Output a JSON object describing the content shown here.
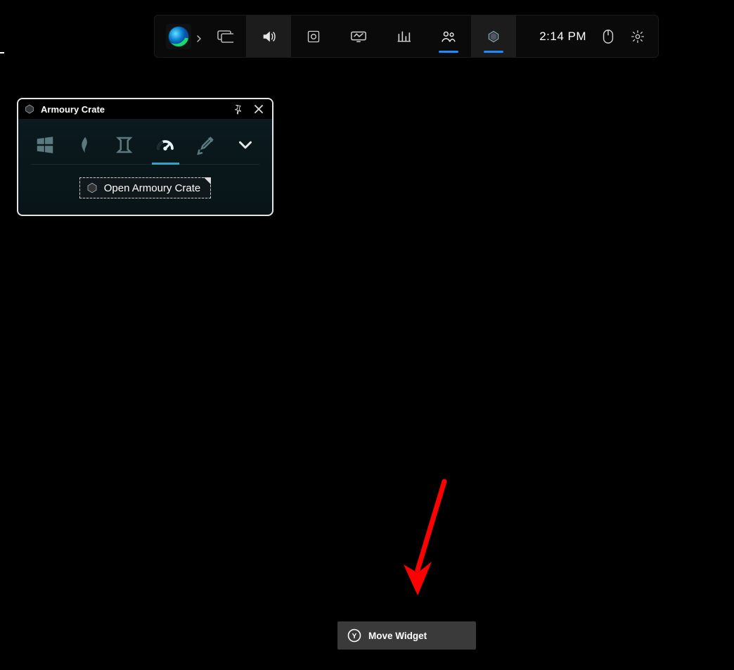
{
  "topbar": {
    "clock": "2:14 PM",
    "apps": {
      "edge_name": "edge-app"
    },
    "icons": {
      "audio": "audio-icon",
      "capture": "capture-icon",
      "projection": "projection-icon",
      "performance": "performance-icon",
      "xbox_social": "xbox-social-icon",
      "armoury_crate": "armoury-crate-icon",
      "mouse": "mouse-icon",
      "settings": "settings-icon"
    }
  },
  "widget": {
    "title": "Armoury Crate",
    "open_button_label": "Open Armoury Crate",
    "modes": {
      "windows": "windows-mode",
      "silent": "silent-mode",
      "performance": "performance-mode",
      "turbo": "turbo-mode",
      "manual": "manual-mode",
      "expand": "expand"
    }
  },
  "hint": {
    "button_glyph": "Y",
    "label": "Move Widget"
  }
}
